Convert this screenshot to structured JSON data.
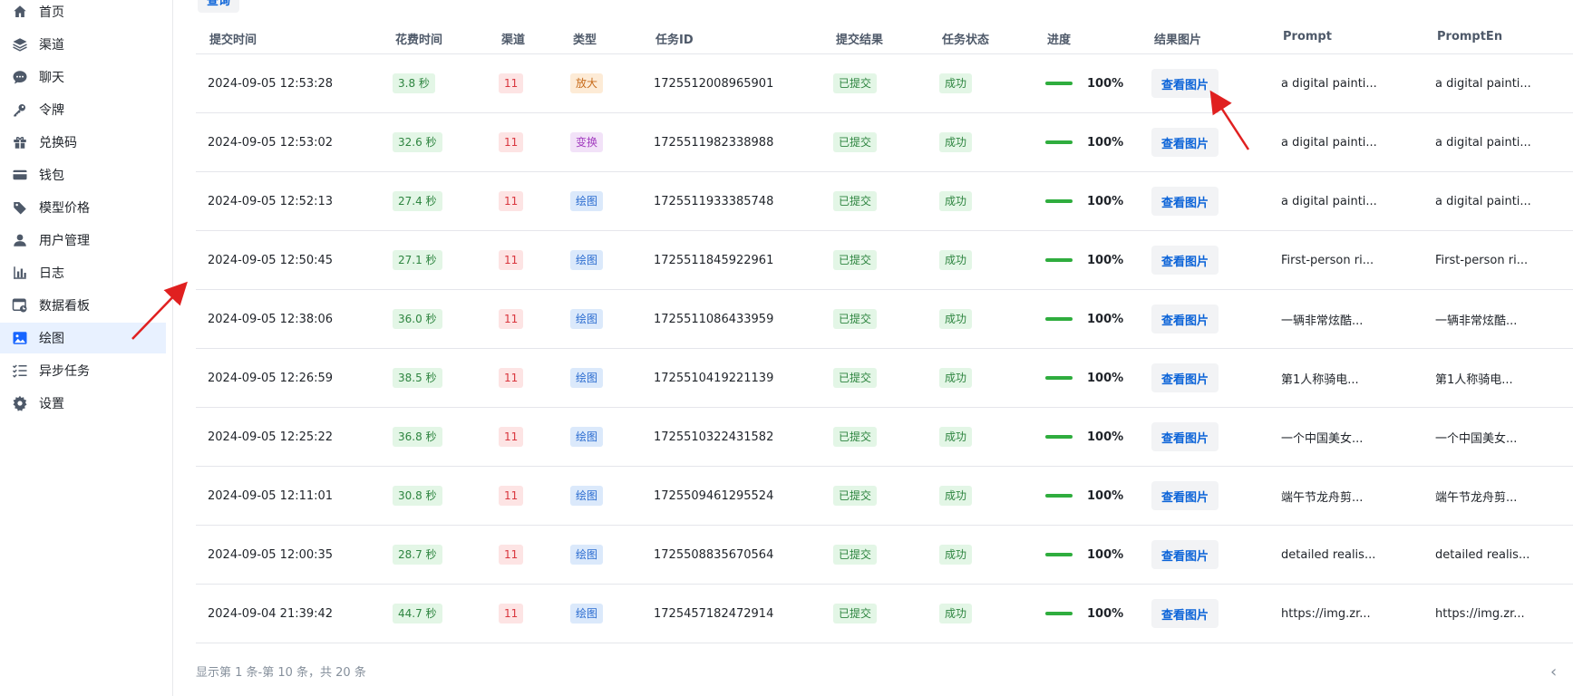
{
  "sidebar": {
    "items": [
      {
        "label": "首页",
        "icon": "home-icon"
      },
      {
        "label": "渠道",
        "icon": "layers-icon"
      },
      {
        "label": "聊天",
        "icon": "chat-icon"
      },
      {
        "label": "令牌",
        "icon": "key-icon"
      },
      {
        "label": "兑换码",
        "icon": "gift-icon"
      },
      {
        "label": "钱包",
        "icon": "wallet-icon"
      },
      {
        "label": "模型价格",
        "icon": "price-tag-icon"
      },
      {
        "label": "用户管理",
        "icon": "user-icon"
      },
      {
        "label": "日志",
        "icon": "bar-chart-icon"
      },
      {
        "label": "数据看板",
        "icon": "dashboard-icon"
      },
      {
        "label": "绘图",
        "icon": "image-icon",
        "active": true
      },
      {
        "label": "异步任务",
        "icon": "task-list-icon"
      },
      {
        "label": "设置",
        "icon": "gear-icon"
      }
    ]
  },
  "query_button": "查询",
  "table": {
    "headers": [
      "提交时间",
      "花费时间",
      "渠道",
      "类型",
      "任务ID",
      "提交结果",
      "任务状态",
      "进度",
      "结果图片",
      "Prompt",
      "PromptEn"
    ],
    "rows": [
      {
        "time": "2024-09-05 12:53:28",
        "cost": "3.8 秒",
        "channel": "11",
        "type": "放大",
        "type_color": "orange",
        "task_id": "1725512008965901",
        "submit": "已提交",
        "status": "成功",
        "progress": "100%",
        "image_btn": "查看图片",
        "prompt": "a digital painti...",
        "prompt_en": "a digital painti..."
      },
      {
        "time": "2024-09-05 12:53:02",
        "cost": "32.6 秒",
        "channel": "11",
        "type": "变换",
        "type_color": "purple",
        "task_id": "1725511982338988",
        "submit": "已提交",
        "status": "成功",
        "progress": "100%",
        "image_btn": "查看图片",
        "prompt": "a digital painti...",
        "prompt_en": "a digital painti..."
      },
      {
        "time": "2024-09-05 12:52:13",
        "cost": "27.4 秒",
        "channel": "11",
        "type": "绘图",
        "type_color": "blue",
        "task_id": "1725511933385748",
        "submit": "已提交",
        "status": "成功",
        "progress": "100%",
        "image_btn": "查看图片",
        "prompt": "a digital painti...",
        "prompt_en": "a digital painti..."
      },
      {
        "time": "2024-09-05 12:50:45",
        "cost": "27.1 秒",
        "channel": "11",
        "type": "绘图",
        "type_color": "blue",
        "task_id": "1725511845922961",
        "submit": "已提交",
        "status": "成功",
        "progress": "100%",
        "image_btn": "查看图片",
        "prompt": "First-person ri...",
        "prompt_en": "First-person ri..."
      },
      {
        "time": "2024-09-05 12:38:06",
        "cost": "36.0 秒",
        "channel": "11",
        "type": "绘图",
        "type_color": "blue",
        "task_id": "1725511086433959",
        "submit": "已提交",
        "status": "成功",
        "progress": "100%",
        "image_btn": "查看图片",
        "prompt": "一辆非常炫酷...",
        "prompt_en": "一辆非常炫酷..."
      },
      {
        "time": "2024-09-05 12:26:59",
        "cost": "38.5 秒",
        "channel": "11",
        "type": "绘图",
        "type_color": "blue",
        "task_id": "1725510419221139",
        "submit": "已提交",
        "status": "成功",
        "progress": "100%",
        "image_btn": "查看图片",
        "prompt": "第1人称骑电...",
        "prompt_en": "第1人称骑电..."
      },
      {
        "time": "2024-09-05 12:25:22",
        "cost": "36.8 秒",
        "channel": "11",
        "type": "绘图",
        "type_color": "blue",
        "task_id": "1725510322431582",
        "submit": "已提交",
        "status": "成功",
        "progress": "100%",
        "image_btn": "查看图片",
        "prompt": "一个中国美女...",
        "prompt_en": "一个中国美女..."
      },
      {
        "time": "2024-09-05 12:11:01",
        "cost": "30.8 秒",
        "channel": "11",
        "type": "绘图",
        "type_color": "blue",
        "task_id": "1725509461295524",
        "submit": "已提交",
        "status": "成功",
        "progress": "100%",
        "image_btn": "查看图片",
        "prompt": "端午节龙舟剪...",
        "prompt_en": "端午节龙舟剪..."
      },
      {
        "time": "2024-09-05 12:00:35",
        "cost": "28.7 秒",
        "channel": "11",
        "type": "绘图",
        "type_color": "blue",
        "task_id": "1725508835670564",
        "submit": "已提交",
        "status": "成功",
        "progress": "100%",
        "image_btn": "查看图片",
        "prompt": "detailed realis...",
        "prompt_en": "detailed realis..."
      },
      {
        "time": "2024-09-04 21:39:42",
        "cost": "44.7 秒",
        "channel": "11",
        "type": "绘图",
        "type_color": "blue",
        "task_id": "1725457182472914",
        "submit": "已提交",
        "status": "成功",
        "progress": "100%",
        "image_btn": "查看图片",
        "prompt": "https://img.zr...",
        "prompt_en": "https://img.zr..."
      }
    ]
  },
  "footer": {
    "pagination_text": "显示第 1 条-第 10 条，共 20 条"
  },
  "colors": {
    "accent": "#0b63d8",
    "active_bg": "#e8f1ff",
    "progress": "#2fad3e",
    "annotation_arrow": "#e02020"
  }
}
